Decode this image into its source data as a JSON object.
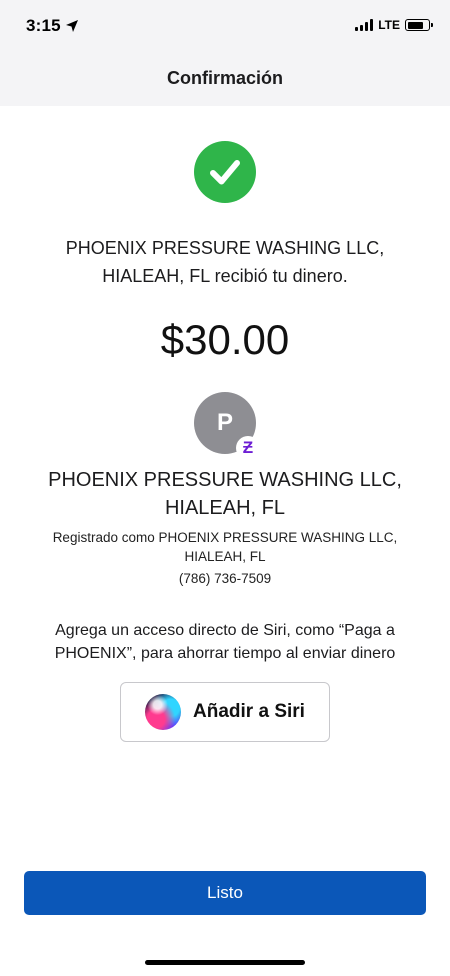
{
  "status_bar": {
    "time": "3:15",
    "network": "LTE",
    "icons": [
      "location-arrow-icon",
      "signal-icon",
      "battery-icon"
    ]
  },
  "nav": {
    "title": "Confirmación"
  },
  "confirmation": {
    "icon": "checkmark-circle-icon",
    "message_line1": "PHOENIX PRESSURE WASHING LLC,",
    "message_line2": "HIALEAH, FL recibió tu dinero.",
    "amount": "$30.00"
  },
  "recipient": {
    "avatar_initial": "P",
    "badge_glyph": "Ƶ",
    "name_line1": "PHOENIX PRESSURE WASHING LLC,",
    "name_line2": "HIALEAH, FL",
    "registered_line1": "Registrado como PHOENIX PRESSURE WASHING LLC,",
    "registered_line2": "HIALEAH, FL",
    "phone": "(786) 736-7509"
  },
  "siri": {
    "promo_line1": "Agrega un acceso directo de Siri, como “Paga a",
    "promo_line2": "PHOENIX”, para ahorrar tiempo al enviar dinero",
    "button_label": "Añadir a Siri"
  },
  "footer": {
    "done_label": "Listo"
  },
  "colors": {
    "success": "#2fb54a",
    "primary": "#0b57b8",
    "zelle": "#6d1ed4",
    "avatar": "#8e8e93"
  }
}
